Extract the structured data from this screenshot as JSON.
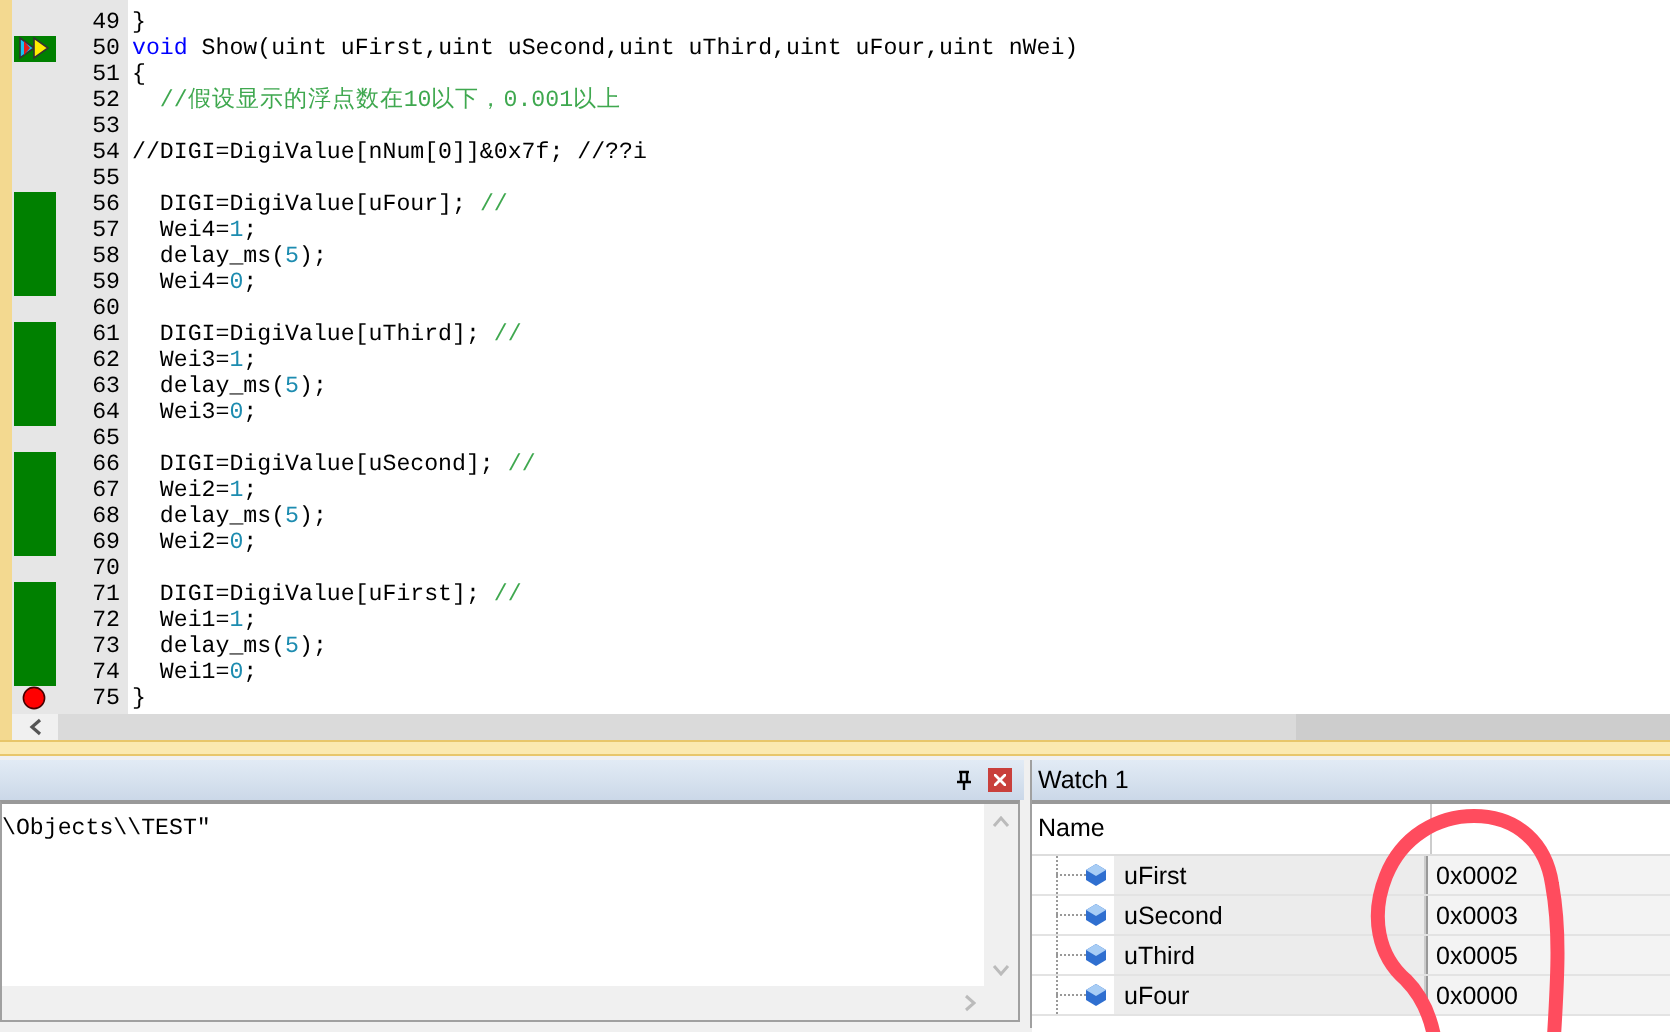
{
  "editor": {
    "lines": [
      {
        "num": "49",
        "covered": false,
        "tokens": [
          {
            "text": "}",
            "kind": "plain"
          }
        ]
      },
      {
        "num": "50",
        "covered": true,
        "current": true,
        "tokens": [
          {
            "text": "void",
            "kind": "keyword"
          },
          {
            "text": " Show(uint uFirst,uint uSecond,uint uThird,uint uFour,uint nWei)",
            "kind": "plain"
          }
        ]
      },
      {
        "num": "51",
        "covered": false,
        "tokens": [
          {
            "text": "{",
            "kind": "plain"
          }
        ]
      },
      {
        "num": "52",
        "covered": false,
        "tokens": [
          {
            "text": "  //假设显示的浮点数在10以下，0.001以上",
            "kind": "comment"
          }
        ]
      },
      {
        "num": "53",
        "covered": false
      },
      {
        "num": "54",
        "covered": false,
        "tokens": [
          {
            "text": "//DIGI=DigiValue[nNum[0]]&0x7f; //??i",
            "kind": "plain"
          }
        ]
      },
      {
        "num": "55",
        "covered": false
      },
      {
        "num": "56",
        "covered": true,
        "tokens": [
          {
            "text": "  DIGI=DigiValue[uFour]; ",
            "kind": "plain"
          },
          {
            "text": "//",
            "kind": "comment"
          }
        ]
      },
      {
        "num": "57",
        "covered": true,
        "tokens": [
          {
            "text": "  Wei4=",
            "kind": "plain"
          },
          {
            "text": "1",
            "kind": "number"
          },
          {
            "text": ";",
            "kind": "plain"
          }
        ]
      },
      {
        "num": "58",
        "covered": true,
        "tokens": [
          {
            "text": "  delay_ms(",
            "kind": "plain"
          },
          {
            "text": "5",
            "kind": "number"
          },
          {
            "text": ");",
            "kind": "plain"
          }
        ]
      },
      {
        "num": "59",
        "covered": true,
        "tokens": [
          {
            "text": "  Wei4=",
            "kind": "plain"
          },
          {
            "text": "0",
            "kind": "number"
          },
          {
            "text": ";",
            "kind": "plain"
          }
        ]
      },
      {
        "num": "60",
        "covered": false
      },
      {
        "num": "61",
        "covered": true,
        "tokens": [
          {
            "text": "  DIGI=DigiValue[uThird]; ",
            "kind": "plain"
          },
          {
            "text": "//",
            "kind": "comment"
          }
        ]
      },
      {
        "num": "62",
        "covered": true,
        "tokens": [
          {
            "text": "  Wei3=",
            "kind": "plain"
          },
          {
            "text": "1",
            "kind": "number"
          },
          {
            "text": ";",
            "kind": "plain"
          }
        ]
      },
      {
        "num": "63",
        "covered": true,
        "tokens": [
          {
            "text": "  delay_ms(",
            "kind": "plain"
          },
          {
            "text": "5",
            "kind": "number"
          },
          {
            "text": ");",
            "kind": "plain"
          }
        ]
      },
      {
        "num": "64",
        "covered": true,
        "tokens": [
          {
            "text": "  Wei3=",
            "kind": "plain"
          },
          {
            "text": "0",
            "kind": "number"
          },
          {
            "text": ";",
            "kind": "plain"
          }
        ]
      },
      {
        "num": "65",
        "covered": false
      },
      {
        "num": "66",
        "covered": true,
        "tokens": [
          {
            "text": "  DIGI=DigiValue[uSecond]; ",
            "kind": "plain"
          },
          {
            "text": "//",
            "kind": "comment"
          }
        ]
      },
      {
        "num": "67",
        "covered": true,
        "tokens": [
          {
            "text": "  Wei2=",
            "kind": "plain"
          },
          {
            "text": "1",
            "kind": "number"
          },
          {
            "text": ";",
            "kind": "plain"
          }
        ]
      },
      {
        "num": "68",
        "covered": true,
        "tokens": [
          {
            "text": "  delay_ms(",
            "kind": "plain"
          },
          {
            "text": "5",
            "kind": "number"
          },
          {
            "text": ");",
            "kind": "plain"
          }
        ]
      },
      {
        "num": "69",
        "covered": true,
        "tokens": [
          {
            "text": "  Wei2=",
            "kind": "plain"
          },
          {
            "text": "0",
            "kind": "number"
          },
          {
            "text": ";",
            "kind": "plain"
          }
        ]
      },
      {
        "num": "70",
        "covered": false
      },
      {
        "num": "71",
        "covered": true,
        "tokens": [
          {
            "text": "  DIGI=DigiValue[uFirst]; ",
            "kind": "plain"
          },
          {
            "text": "//",
            "kind": "comment"
          }
        ]
      },
      {
        "num": "72",
        "covered": true,
        "tokens": [
          {
            "text": "  Wei1=",
            "kind": "plain"
          },
          {
            "text": "1",
            "kind": "number"
          },
          {
            "text": ";",
            "kind": "plain"
          }
        ]
      },
      {
        "num": "73",
        "covered": true,
        "tokens": [
          {
            "text": "  delay_ms(",
            "kind": "plain"
          },
          {
            "text": "5",
            "kind": "number"
          },
          {
            "text": ");",
            "kind": "plain"
          }
        ]
      },
      {
        "num": "74",
        "covered": true,
        "tokens": [
          {
            "text": "  Wei1=",
            "kind": "plain"
          },
          {
            "text": "0",
            "kind": "number"
          },
          {
            "text": ";",
            "kind": "plain"
          }
        ]
      },
      {
        "num": "75",
        "covered": false,
        "breakpoint": true,
        "tokens": [
          {
            "text": "}",
            "kind": "plain"
          }
        ]
      }
    ]
  },
  "output": {
    "text": "\\Objects\\\\TEST\""
  },
  "watch": {
    "title": "Watch 1",
    "columns": [
      "Name"
    ],
    "rows": [
      {
        "name": "uFirst",
        "value": "0x0002"
      },
      {
        "name": "uSecond",
        "value": "0x0003"
      },
      {
        "name": "uThird",
        "value": "0x0005"
      },
      {
        "name": "uFour",
        "value": "0x0000"
      }
    ]
  }
}
